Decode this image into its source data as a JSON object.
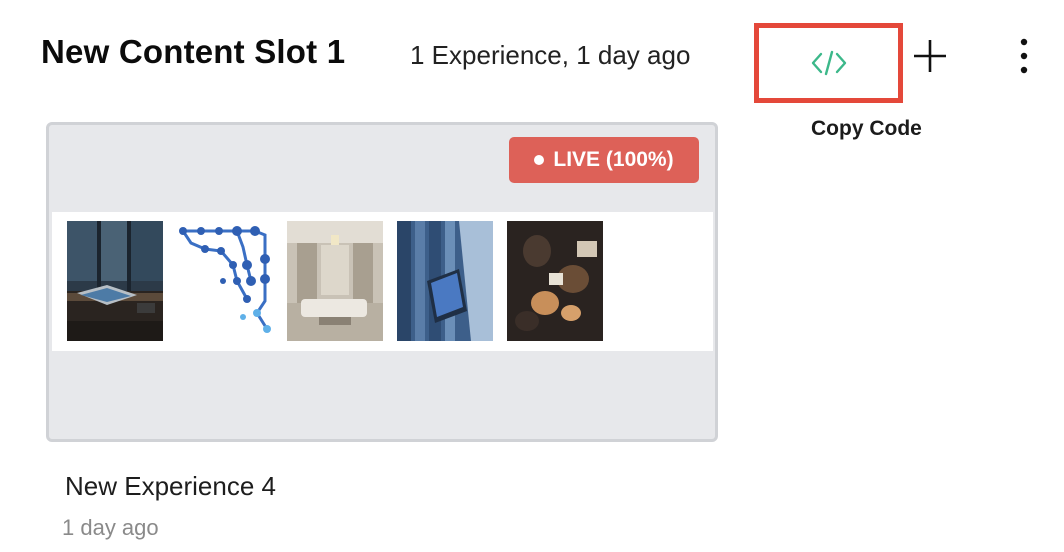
{
  "slot": {
    "title": "New Content Slot 1",
    "meta": "1 Experience, 1 day ago"
  },
  "toolbar": {
    "copy_code_label": "Copy Code",
    "code_icon": "code-brackets-icon",
    "add_icon": "plus-icon",
    "more_icon": "vertical-ellipsis-icon",
    "highlight_color": "#e4483a",
    "code_icon_color": "#3cb88a"
  },
  "experience": {
    "status_badge": "LIVE (100%)",
    "status_color": "#dd6158",
    "title": "New Experience 4",
    "time": "1 day ago",
    "thumbnails": [
      {
        "icon": "laptop-desk-photo"
      },
      {
        "icon": "blue-dot-network-graphic"
      },
      {
        "icon": "interior-room-photo"
      },
      {
        "icon": "tablet-library-photo"
      },
      {
        "icon": "people-meeting-photo"
      }
    ]
  }
}
